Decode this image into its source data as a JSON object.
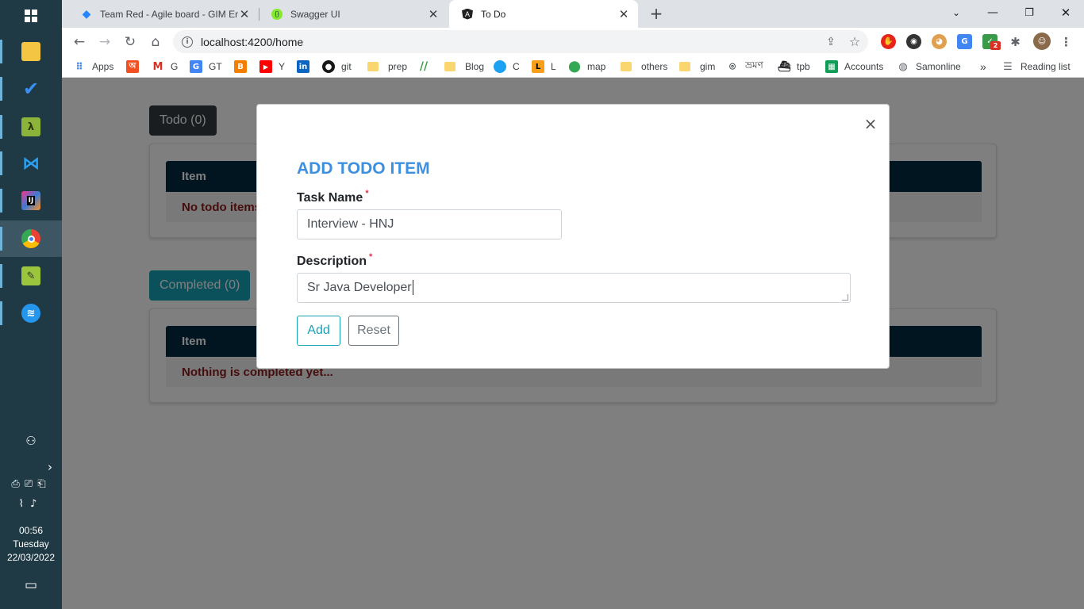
{
  "taskbar": {
    "apps": [
      {
        "name": "file-explorer-icon"
      },
      {
        "name": "todo-app-icon"
      },
      {
        "name": "lambda-app-icon"
      },
      {
        "name": "vscode-icon"
      },
      {
        "name": "intellij-icon"
      },
      {
        "name": "chrome-icon"
      },
      {
        "name": "notepad-icon"
      },
      {
        "name": "docker-icon"
      }
    ],
    "clock": {
      "time": "00:56",
      "day": "Tuesday",
      "date": "22/03/2022"
    }
  },
  "browser": {
    "tabs": [
      {
        "title": "Team Red - Agile board - GIM En",
        "active": false
      },
      {
        "title": "Swagger UI",
        "active": false
      },
      {
        "title": "To Do",
        "active": true
      }
    ],
    "url": "localhost:4200/home",
    "bookmarks": [
      {
        "label": "Apps"
      },
      {
        "label": ""
      },
      {
        "label": "G"
      },
      {
        "label": "GT"
      },
      {
        "label": ""
      },
      {
        "label": "Y"
      },
      {
        "label": ""
      },
      {
        "label": "git"
      },
      {
        "label": "prep"
      },
      {
        "label": ""
      },
      {
        "label": "Blog"
      },
      {
        "label": "C"
      },
      {
        "label": "L"
      },
      {
        "label": "map"
      },
      {
        "label": "others"
      },
      {
        "label": "gim"
      },
      {
        "label": "ভ্রমণ"
      },
      {
        "label": "tpb"
      },
      {
        "label": "Accounts"
      },
      {
        "label": "Samonline"
      }
    ],
    "more_bookmarks": "»",
    "reading_list": "Reading list"
  },
  "page": {
    "todo_button": "Todo (0)",
    "todo_table_header": "Item",
    "todo_empty": "No todo items",
    "completed_button": "Completed (0)",
    "completed_table_header": "Item",
    "completed_empty": "Nothing is completed yet..."
  },
  "modal": {
    "title": "ADD TODO ITEM",
    "task_name_label": "Task Name",
    "task_name_value": "Interview - HNJ",
    "description_label": "Description",
    "description_value": "Sr Java Developer",
    "required_mark": "*",
    "add_label": "Add",
    "reset_label": "Reset",
    "close_glyph": "×"
  },
  "colors": {
    "modal_title": "#3d8fe0",
    "table_header": "#002a40",
    "empty_text": "#8b1a1a",
    "completed_button": "#17a2b8",
    "add_button": "#17a2b8"
  }
}
